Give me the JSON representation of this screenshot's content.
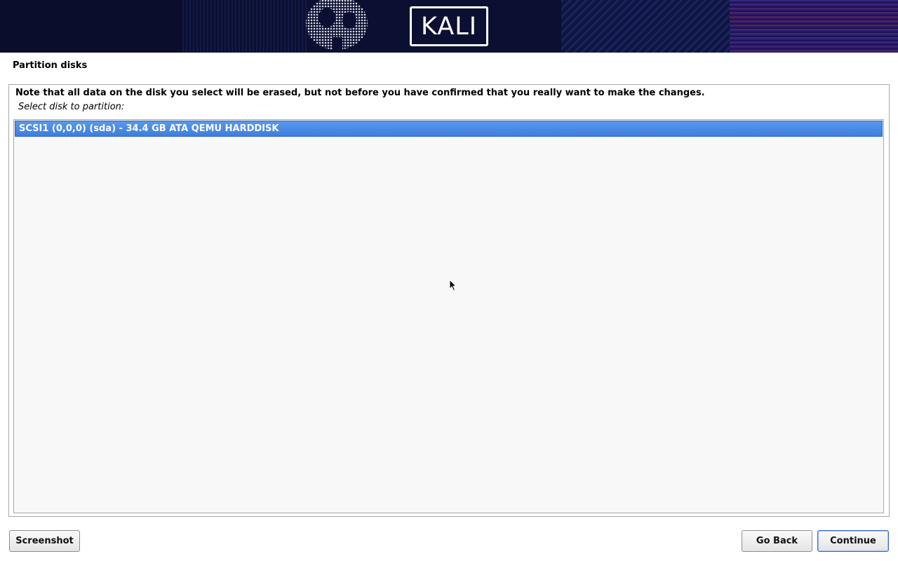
{
  "banner": {
    "logo_text": "KALI"
  },
  "installer": {
    "title": "Partition disks",
    "note": "Note that all data on the disk you select will be erased, but not before you have confirmed that you really want to make the changes.",
    "prompt": "Select disk to partition:",
    "disks": [
      {
        "label": "SCSI1 (0,0,0) (sda) - 34.4 GB ATA QEMU HARDDISK",
        "selected": true
      }
    ]
  },
  "buttons": {
    "screenshot": "Screenshot",
    "go_back": "Go Back",
    "continue": "Continue"
  },
  "colors": {
    "banner_bg": "#0b1033",
    "selection": "#3d7ee0"
  }
}
